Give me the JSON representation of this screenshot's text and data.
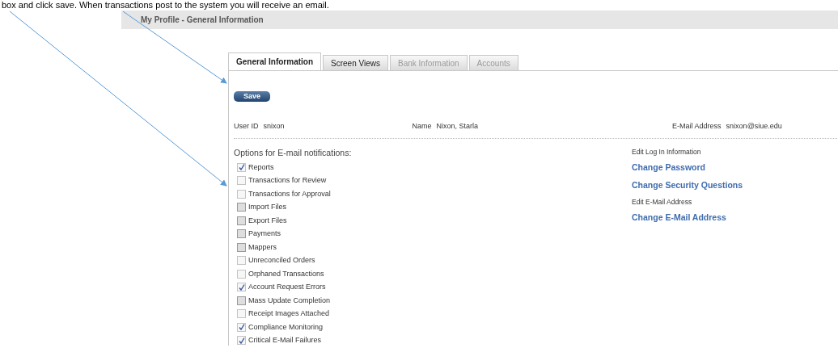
{
  "instruction": "box and click save.  When transactions post to the system you will receive an email.",
  "header": {
    "title": "My Profile - General Information"
  },
  "tabs": [
    {
      "label": "General Information",
      "selected": true,
      "disabled": false
    },
    {
      "label": "Screen Views",
      "selected": false,
      "disabled": false
    },
    {
      "label": "Bank Information",
      "selected": false,
      "disabled": true
    },
    {
      "label": "Accounts",
      "selected": false,
      "disabled": true
    }
  ],
  "save_button": "Save",
  "user_info": [
    {
      "label": "User ID",
      "value": "snixon"
    },
    {
      "label": "Name",
      "value": "Nixon, Starla"
    },
    {
      "label": "E-Mail Address",
      "value": "snixon@siue.edu"
    }
  ],
  "notifications": {
    "title": "Options for E-mail notifications:",
    "options": [
      {
        "label": "Reports",
        "checked": true,
        "disabled": false
      },
      {
        "label": "Transactions for Review",
        "checked": false,
        "disabled": false
      },
      {
        "label": "Transactions for Approval",
        "checked": false,
        "disabled": false
      },
      {
        "label": "Import Files",
        "checked": false,
        "disabled": true
      },
      {
        "label": "Export Files",
        "checked": false,
        "disabled": true
      },
      {
        "label": "Payments",
        "checked": false,
        "disabled": true
      },
      {
        "label": "Mappers",
        "checked": false,
        "disabled": true
      },
      {
        "label": "Unreconciled Orders",
        "checked": false,
        "disabled": false
      },
      {
        "label": "Orphaned Transactions",
        "checked": false,
        "disabled": false
      },
      {
        "label": "Account Request Errors",
        "checked": true,
        "disabled": false
      },
      {
        "label": "Mass Update Completion",
        "checked": false,
        "disabled": true
      },
      {
        "label": "Receipt Images Attached",
        "checked": false,
        "disabled": false
      },
      {
        "label": "Compliance Monitoring",
        "checked": true,
        "disabled": false
      },
      {
        "label": "Critical E-Mail Failures",
        "checked": true,
        "disabled": false
      }
    ]
  },
  "links": [
    {
      "kind": "heading",
      "text": "Edit Log In Information"
    },
    {
      "kind": "link",
      "text": "Change Password"
    },
    {
      "kind": "link",
      "text": "Change Security Questions"
    },
    {
      "kind": "heading",
      "text": "Edit E-Mail Address"
    },
    {
      "kind": "link",
      "text": "Change E-Mail Address"
    }
  ]
}
